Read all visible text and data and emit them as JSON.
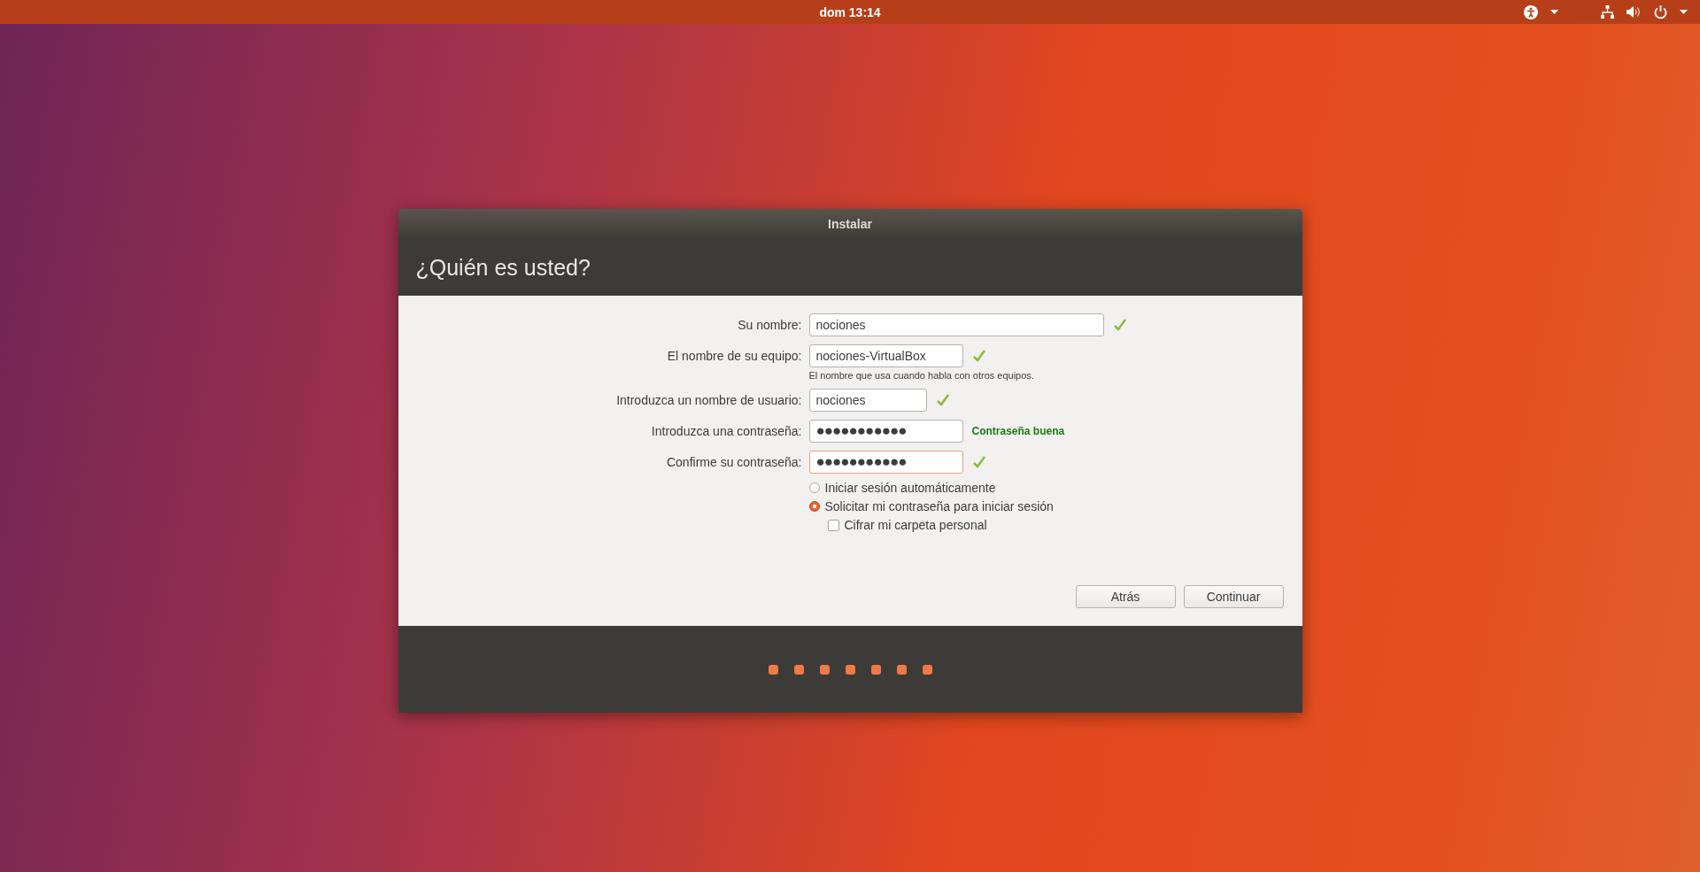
{
  "top_bar": {
    "clock": "dom 13:14"
  },
  "window": {
    "title": "Instalar",
    "heading": "¿Quién es usted?"
  },
  "fields": [
    {
      "label": "Su nombre:",
      "value": "nociones",
      "valid": true,
      "focused": false,
      "kind": "name"
    },
    {
      "label": "El nombre de su equipo:",
      "value": "nociones-VirtualBox",
      "valid": true,
      "focused": false,
      "kind": "hostname",
      "hint": "El nombre que usa cuando habla con otros equipos."
    },
    {
      "label": "Introduzca un nombre de usuario:",
      "value": "nociones",
      "valid": true,
      "focused": false,
      "kind": "username"
    },
    {
      "label": "Introduzca una contraseña:",
      "value": "●●●●●●●●●●●",
      "focused": false,
      "kind": "password",
      "strength": "Contraseña buena"
    },
    {
      "label": "Confirme su contraseña:",
      "value": "●●●●●●●●●●●",
      "valid": true,
      "focused": true,
      "kind": "password"
    }
  ],
  "login_options": [
    {
      "label": "Iniciar sesión automáticamente",
      "selected": false
    },
    {
      "label": "Solicitar mi contraseña para iniciar sesión",
      "selected": true
    }
  ],
  "encrypt": {
    "label": "Cifrar mi carpeta personal",
    "checked": false
  },
  "buttons": [
    "Atrás",
    "Continuar"
  ]
}
